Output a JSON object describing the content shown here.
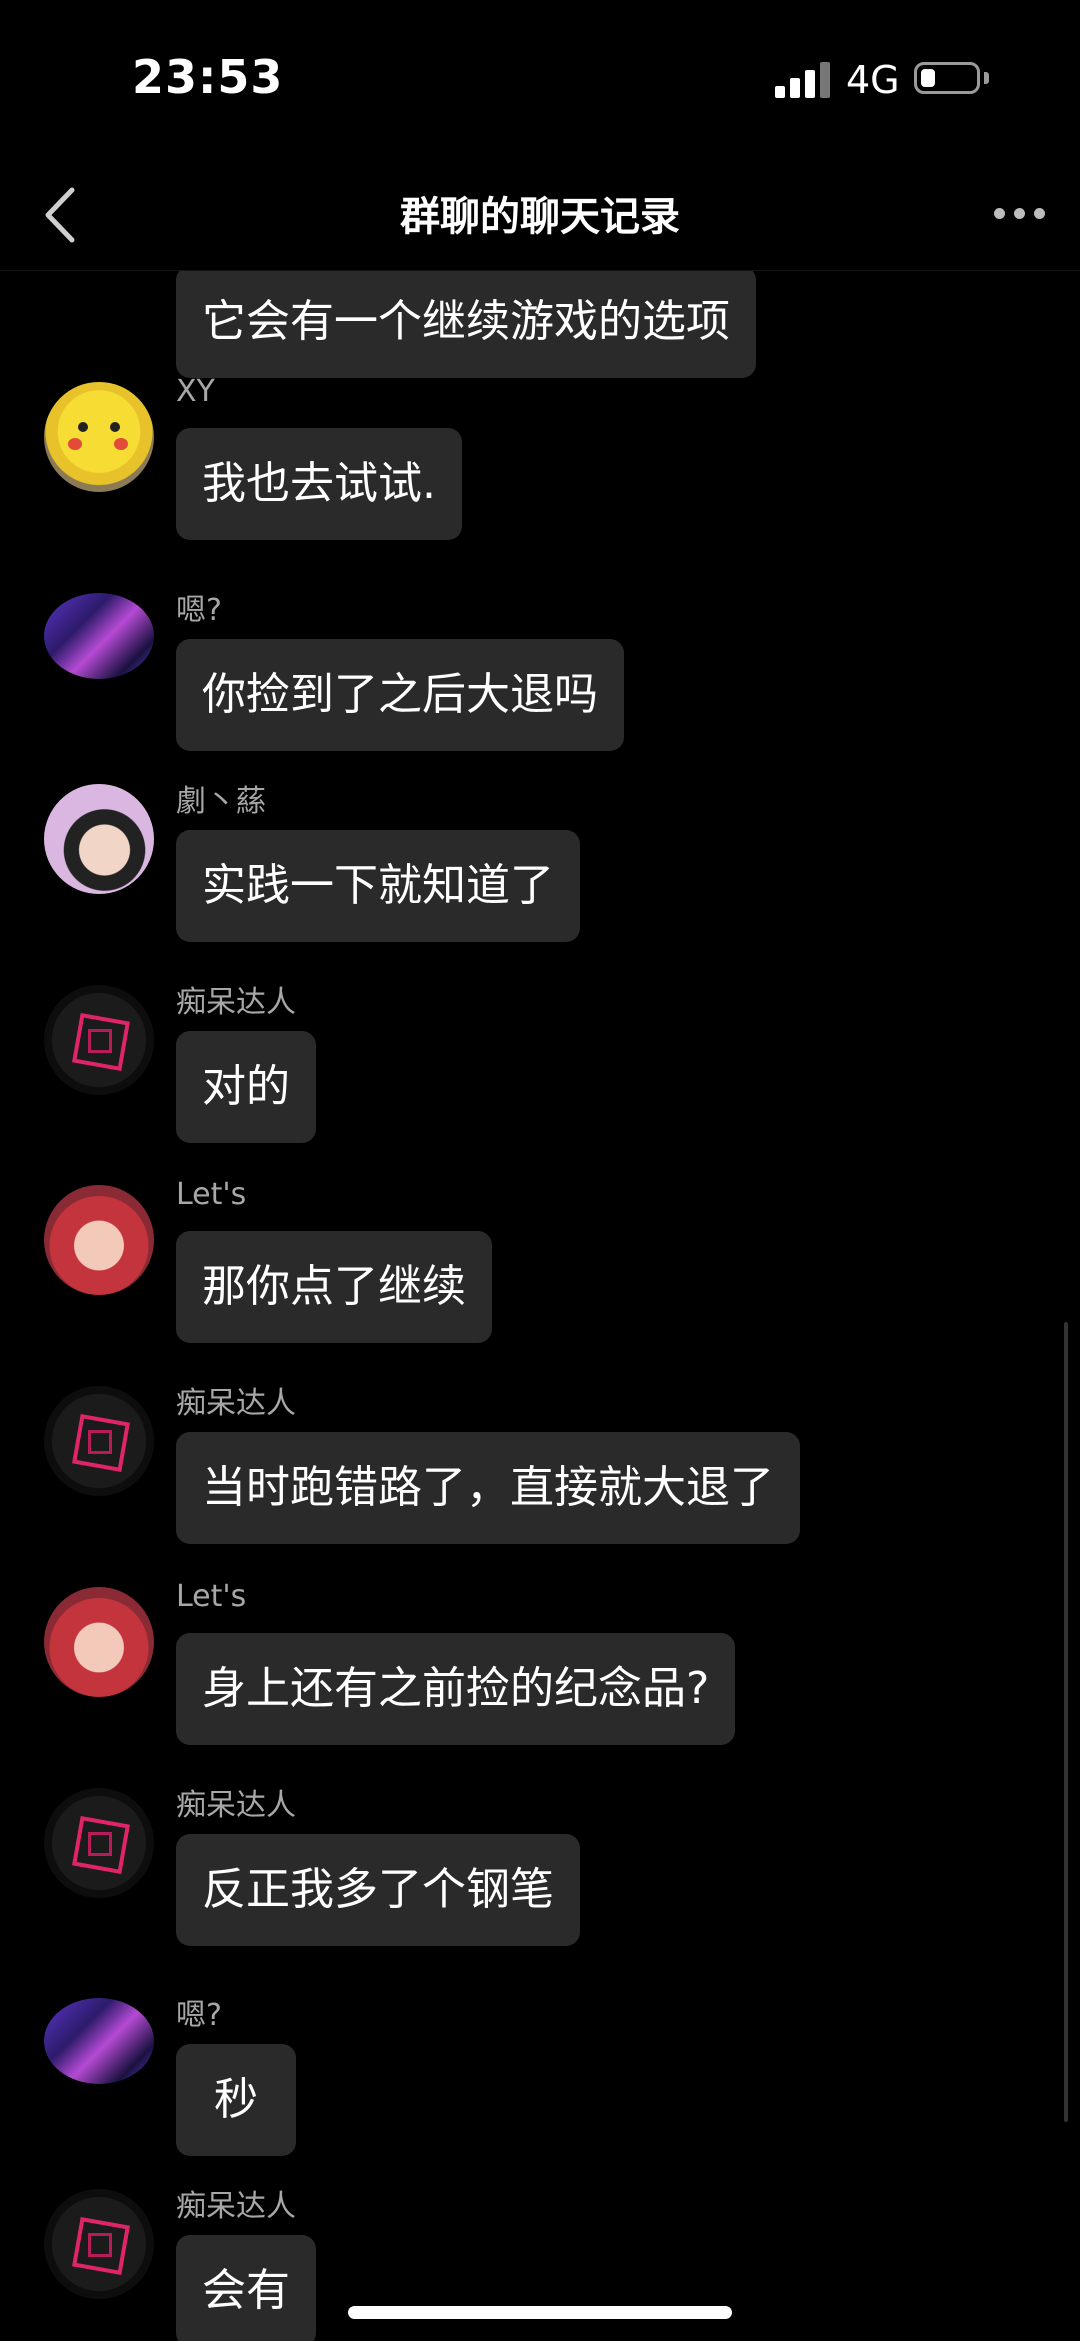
{
  "status_bar": {
    "time": "23:53",
    "network": "4G",
    "battery_level": 0.25
  },
  "nav": {
    "title": "群聊的聊天记录",
    "back_icon": "chevron-left-icon",
    "more_icon": "more-dots-icon"
  },
  "messages": [
    {
      "sender": "",
      "text": "它会有一个继续游戏的选项",
      "avatar": "cube-icon"
    },
    {
      "sender": "XY",
      "text": "我也去试试.",
      "avatar": "pikachu-avatar"
    },
    {
      "sender": "嗯?",
      "text": "你捡到了之后大退吗",
      "avatar": "purple-anime-avatar"
    },
    {
      "sender": "劇丶蕬",
      "text": "实践一下就知道了",
      "avatar": "anime-avatar"
    },
    {
      "sender": "痴呆达人",
      "text": "对的",
      "avatar": "cube-avatar"
    },
    {
      "sender": "Let's",
      "text": "那你点了继续",
      "avatar": "red-hair-avatar"
    },
    {
      "sender": "痴呆达人",
      "text": "当时跑错路了，直接就大退了",
      "avatar": "cube-avatar"
    },
    {
      "sender": "Let's",
      "text": "身上还有之前捡的纪念品?",
      "avatar": "red-hair-avatar"
    },
    {
      "sender": "痴呆达人",
      "text": "反正我多了个钢笔",
      "avatar": "cube-avatar"
    },
    {
      "sender": "嗯?",
      "text": "秒",
      "avatar": "purple-anime-avatar"
    },
    {
      "sender": "痴呆达人",
      "text": "会有",
      "avatar": "cube-avatar"
    }
  ]
}
